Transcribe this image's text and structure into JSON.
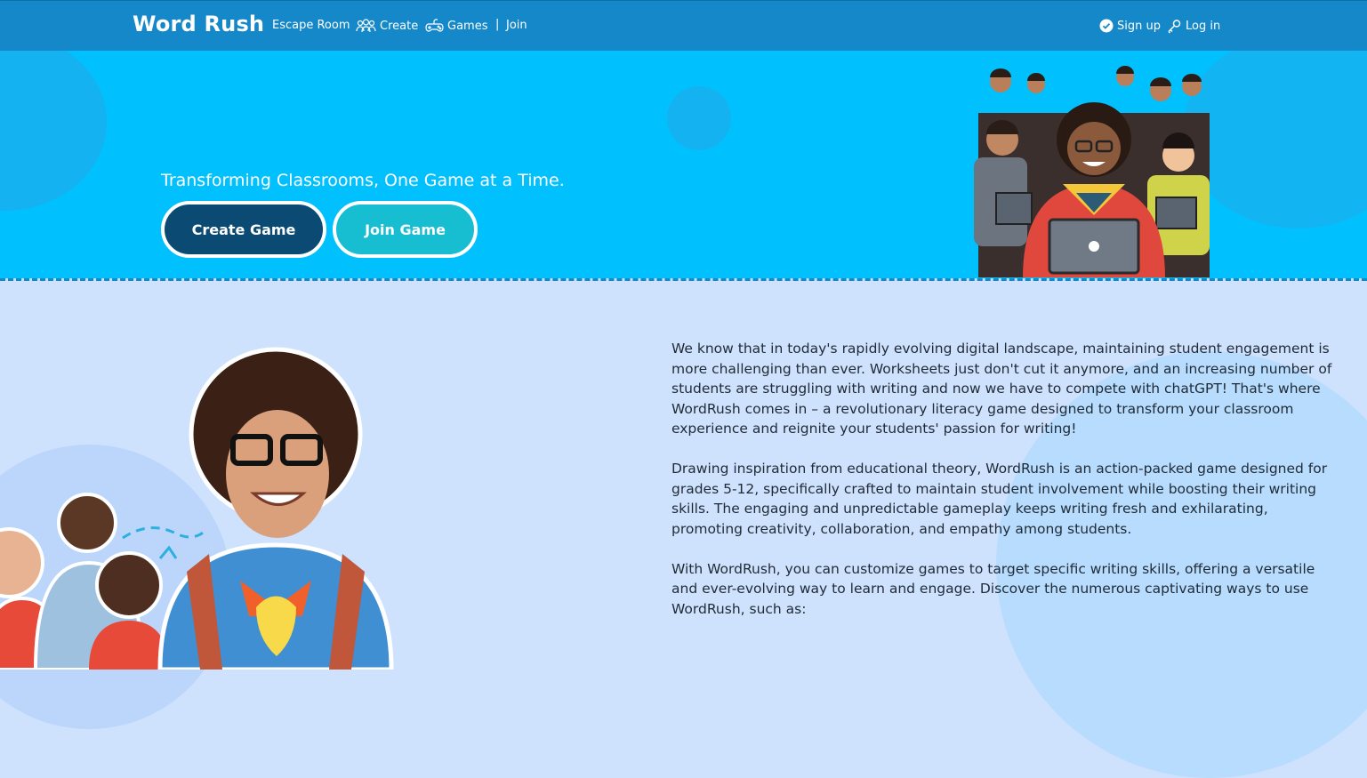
{
  "brand": "Word Rush",
  "nav": {
    "escape_room": "Escape Room",
    "create": "Create",
    "games": "Games",
    "separator": "|",
    "join": "Join",
    "sign_up": "Sign up",
    "log_in": "Log in"
  },
  "hero": {
    "tagline": "Transforming Classrooms, One Game at a Time.",
    "create_game": "Create Game",
    "join_game": "Join Game"
  },
  "intro": {
    "paragraph1": "We know that in today's rapidly evolving digital landscape, maintaining student engagement is more challenging than ever. Worksheets just don't cut it anymore, and an increasing number of students are struggling with writing and now we have to compete with chatGPT! That's where WordRush comes in – a revolutionary literacy game designed to transform your classroom experience and reignite your students' passion for writing!",
    "paragraph2": "Drawing inspiration from educational theory, WordRush is an action-packed game designed for grades 5-12, specifically crafted to maintain student involvement while boosting their writing skills. The engaging and unpredictable gameplay keeps writing fresh and exhilarating, promoting creativity, collaboration, and empathy among students.",
    "paragraph3": "With WordRush, you can customize games to target specific writing skills, offering a versatile and ever-evolving way to learn and engage. Discover the numerous captivating ways to use WordRush, such as:"
  },
  "colors": {
    "nav": "#1488c8",
    "hero": "#00c1fe",
    "body": "#cfe2fd",
    "create_button": "#0a4a73",
    "join_button": "#17bdd1"
  },
  "icons": [
    "people-icon",
    "controller-icon",
    "check-circle-icon",
    "login-key-icon"
  ]
}
